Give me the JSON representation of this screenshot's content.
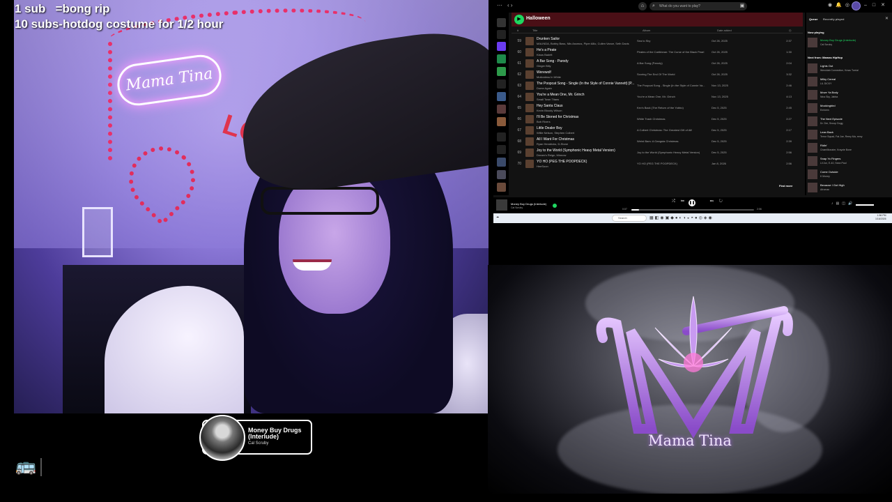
{
  "overlay": {
    "line1": "1 sub   =bong rip",
    "line2": "10 subs-hotdog costume for 1/2 hour"
  },
  "webcam": {
    "neon_sign": "Mama Tina",
    "love_sign": "LOVE"
  },
  "now_playing_card": {
    "title": "Money Buy Drugs (Interlude)",
    "artist": "Cal Scruby"
  },
  "bus_icon": "bus-icon",
  "spotify": {
    "search_placeholder": "What do you want to play?",
    "playlist_title": "Halloween",
    "columns": {
      "num": "#",
      "title": "Title",
      "album": "Album",
      "date": "Date added",
      "duration": "◷"
    },
    "rows": [
      {
        "num": "59",
        "title": "Drunken Sailor",
        "artist": "MALINDA, Bobby Bass, Nils Assmus, Piper Alllo, Cullen Vance, Seth Davis",
        "album": "Sea to Sky",
        "date": "Oct 26, 2025",
        "duration": "2:37"
      },
      {
        "num": "60",
        "title": "He's a Pirate",
        "artist": "Klaus Badelt",
        "album": "Pirates of the Caribbean: The Curse of the Black Pearl",
        "date": "Oct 26, 2025",
        "duration": "1:30"
      },
      {
        "num": "61",
        "title": "A Bar Song - Parody",
        "artist": "Ginger Billy",
        "album": "A Bar Song (Parody)",
        "date": "Oct 26, 2025",
        "duration": "2:04"
      },
      {
        "num": "62",
        "title": "Werewolf",
        "artist": "Motionless In White",
        "album": "Scoring The End Of The World",
        "date": "Oct 26, 2025",
        "duration": "3:32"
      },
      {
        "num": "63",
        "title": "The Poopcat Song - Single (In the Style of Connie Vannett) [P...",
        "artist": "Dome Again",
        "album": "The Poopcat Song - Single (In the Style of Connie Va...",
        "date": "Nov 13, 2025",
        "duration": "2:46"
      },
      {
        "num": "64",
        "title": "You're a Mean One, Mr. Grinch",
        "artist": "Small Town Titans",
        "album": "You're a Mean One, Mr. Grinch",
        "date": "Nov 13, 2025",
        "duration": "4:13"
      },
      {
        "num": "65",
        "title": "Hey Santa Claus",
        "artist": "Kevin Bloody Wilson",
        "album": "Kev's Back (The Return of the Yobbo)",
        "date": "Dec 5, 2025",
        "duration": "2:45"
      },
      {
        "num": "66",
        "title": "I'll Be Stoned for Christmas",
        "artist": "Bob Rivers",
        "album": "White Trash Christmas",
        "date": "Dec 5, 2025",
        "duration": "2:27"
      },
      {
        "num": "67",
        "title": "Little Dealer Boy",
        "artist": "Willie Nelson, Stephen Colbert",
        "album": "A Colbert Christmas: The Greatest Gift of All!",
        "date": "Dec 5, 2025",
        "duration": "2:17"
      },
      {
        "num": "68",
        "title": "All I Want For Christmas",
        "artist": "Ryan Hendricks, D-Stone",
        "album": "Weird Bars: A Gangsta Christmas",
        "date": "Dec 5, 2025",
        "duration": "2:39"
      },
      {
        "num": "69",
        "title": "Joy to the World (Symphonic Heavy Metal Version)",
        "artist": "Dream's Reign, Minnow",
        "album": "Joy to the World (Symphonic Heavy Metal Version)",
        "date": "Dec 5, 2025",
        "duration": "2:56"
      },
      {
        "num": "70",
        "title": "YO HO (PEG THE POOPDECK)",
        "artist": "HeeSoon",
        "album": "YO HO (PEG THE POOPDECK)",
        "date": "Jan 8, 2026",
        "duration": "2:56"
      }
    ],
    "find_more": "Find more",
    "queue": {
      "tab_queue": "Queue",
      "tab_recent": "Recently played",
      "now_playing_label": "Now playing",
      "now_playing": {
        "title": "Money Buy Drugs (Interlude)",
        "artist": "Cal Scruby"
      },
      "next_from_label": "Next from: Mamas HipHop",
      "items": [
        {
          "title": "Lights Out",
          "artist": "Wrecklab Connection, Kmac Turrial"
        },
        {
          "title": "Milky Cereal",
          "artist": "LIL DICKY"
        },
        {
          "title": "Move Ya Body",
          "artist": "Nina Sky, Jabba"
        },
        {
          "title": "Mockingbird",
          "artist": "Eminem"
        },
        {
          "title": "The Next Episode",
          "artist": "Dr. Dre, Snoop Dogg"
        },
        {
          "title": "Lean Back",
          "artist": "Terror Squad, Fat Joe, Remy Ma, remy"
        },
        {
          "title": "Ridin'",
          "artist": "Chamillionaire, Krayzie Bone"
        },
        {
          "title": "Snap Yo Fingers",
          "artist": "Lil Jon, E-40, Sean Paul"
        },
        {
          "title": "Come Outside",
          "artist": "K Money"
        },
        {
          "title": "Because I Got High",
          "artist": "Afroman"
        }
      ]
    },
    "player": {
      "title": "Money Buy Drugs (Interlude)",
      "artist": "Cal Scruby",
      "elapsed": "0:07",
      "total": "2:06",
      "progress_fraction": 0.06
    }
  },
  "taskbar": {
    "search": "Search",
    "clock_time": "1:56 PM",
    "clock_date": "1/16/2026"
  },
  "logo": {
    "text": "Mama Tina",
    "accent": "#b56cff"
  }
}
